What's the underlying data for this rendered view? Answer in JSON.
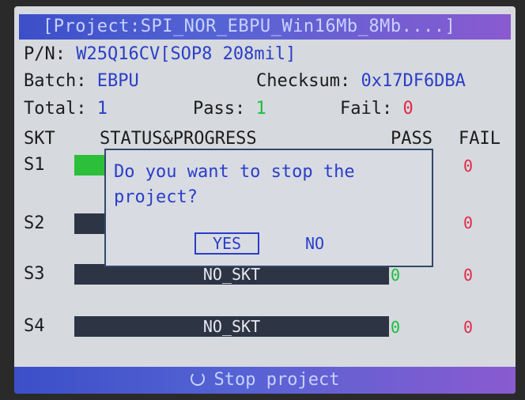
{
  "title": "[Project:SPI_NOR_EBPU_Win16Mb_8Mb....]",
  "pn": {
    "label": "P/N:",
    "value": "W25Q16CV[SOP8 208mil]"
  },
  "batch": {
    "label": "Batch:",
    "value": "EBPU"
  },
  "checksum": {
    "label": "Checksum:",
    "value": "0x17DF6DBA"
  },
  "counts": {
    "total_label": "Total:",
    "total": "1",
    "pass_label": "Pass:",
    "pass": "1",
    "fail_label": "Fail:",
    "fail": "0"
  },
  "table_headers": {
    "skt": "SKT",
    "status": "STATUS&PROGRESS",
    "pass": "PASS",
    "fail": "FAIL"
  },
  "sockets": [
    {
      "label": "S1",
      "status": "",
      "pass": "",
      "fail": "0",
      "progress": 0.1
    },
    {
      "label": "S2",
      "status": "",
      "pass": "",
      "fail": "0",
      "progress": 0
    },
    {
      "label": "S3",
      "status": "NO_SKT",
      "pass": "0",
      "fail": "0",
      "progress": 0
    },
    {
      "label": "S4",
      "status": "NO_SKT",
      "pass": "0",
      "fail": "0",
      "progress": 0
    }
  ],
  "dialog": {
    "message": "Do you want to stop the\nproject?",
    "yes_label": "YES",
    "no_label": "NO"
  },
  "status_bar": {
    "icon": "stop-circle-icon",
    "label": "Stop project"
  },
  "colors": {
    "accent": "#2a3ec8",
    "pass": "#18c040",
    "fail": "#e02a4a",
    "bar": "#2d3545",
    "progress_fill": "#2cbf3a"
  }
}
